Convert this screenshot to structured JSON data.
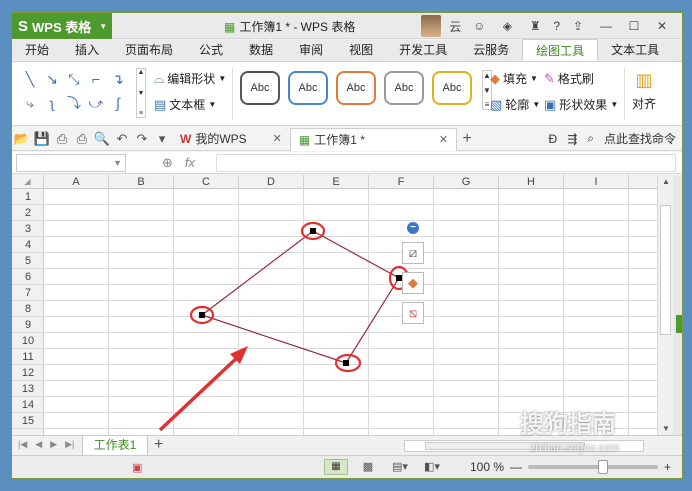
{
  "app": {
    "name": "WPS 表格",
    "logo": "S",
    "doc_title": "工作簿1 * - WPS 表格"
  },
  "title_right": {
    "cloud_label": "云",
    "help_label": "?"
  },
  "ribbon_tabs": [
    "开始",
    "插入",
    "页面布局",
    "公式",
    "数据",
    "审阅",
    "视图",
    "开发工具",
    "云服务",
    "绘图工具",
    "文本工具"
  ],
  "active_tab_index": 9,
  "ribbon": {
    "edit_shape": "编辑形状",
    "text_box": "文本框",
    "style_label": "Abc",
    "style_colors": [
      "#555555",
      "#4a86c8",
      "#e07b39",
      "#999999",
      "#e0b020"
    ],
    "fill": "填充",
    "outline": "轮廓",
    "format_painter": "格式刷",
    "shape_effect": "形状效果",
    "align": "对齐"
  },
  "doc_tabs": [
    {
      "label": "我的WPS",
      "icon": "wps-icon"
    },
    {
      "label": "工作簿1 *",
      "icon": "spreadsheet-icon"
    }
  ],
  "quick_right": {
    "search": "点此查找命令"
  },
  "formula_bar": {
    "fx": "fx"
  },
  "columns": [
    "A",
    "B",
    "C",
    "D",
    "E",
    "F",
    "G",
    "H",
    "I"
  ],
  "rows": [
    "1",
    "2",
    "3",
    "4",
    "5",
    "6",
    "7",
    "8",
    "9",
    "10",
    "11",
    "12",
    "13",
    "14",
    "15"
  ],
  "sheets": [
    "工作表1"
  ],
  "zoom": {
    "label": "100 %",
    "value": 100
  },
  "watermark": {
    "main": "搜狗指南",
    "sub": "zhinan.sogou.com"
  }
}
